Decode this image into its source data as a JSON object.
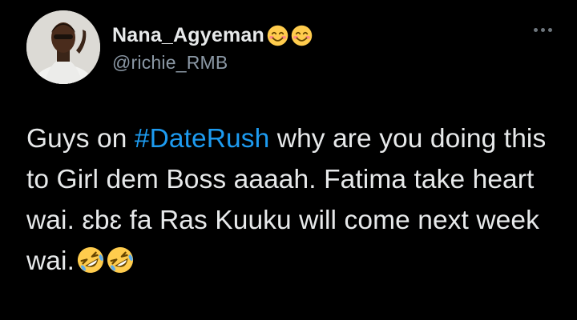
{
  "user": {
    "display_name": "Nana_Agyeman",
    "name_emoji": [
      "smiling-face-with-smiling-eyes",
      "smiling-face-with-smiling-eyes"
    ],
    "handle": "@richie_RMB"
  },
  "tweet": {
    "text_before": "Guys on ",
    "hashtag": "#DateRush",
    "text_after": " why are you doing this to Girl dem Boss aaaah. Fatima take heart wai. ɛbɛ fa Ras Kuuku will come next week wai.",
    "trailing_emoji": [
      "rolling-on-the-floor-laughing",
      "rolling-on-the-floor-laughing"
    ]
  },
  "colors": {
    "background": "#000000",
    "text": "#e7e9ea",
    "secondary": "#8b98a5",
    "link": "#1d9bf0"
  },
  "icons": {
    "more": "more-horizontal-icon"
  }
}
